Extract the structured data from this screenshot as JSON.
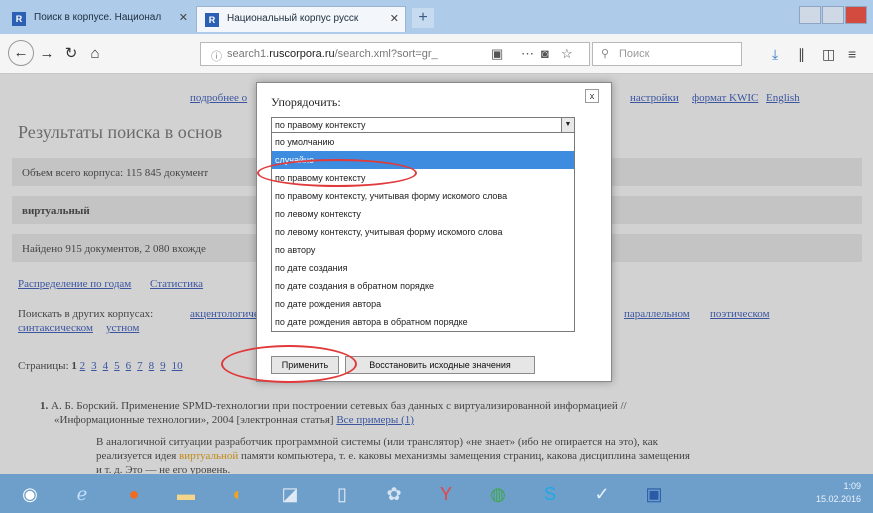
{
  "browser": {
    "tabs": [
      {
        "title": "Поиск в корпусе. Национал"
      },
      {
        "title": "Национальный корпус русск"
      }
    ],
    "new_tab": "+",
    "url": {
      "prefix": "search1.",
      "domain": "ruscorpora.ru",
      "path": "/search.xml?sort=gr_"
    },
    "search_placeholder": "Поиск"
  },
  "page": {
    "top_links": [
      "подробнее о",
      "настройки",
      "формат KWIC",
      "English"
    ],
    "title": "Результаты поиска в основ",
    "rows": [
      "Объем всего корпуса: 115 845 документ",
      "виртуальный",
      "Найдено 915 документов, 2 080 вхожде"
    ],
    "links1": [
      "Распределение по годам",
      "Статистика"
    ],
    "search_other_label": "Поискать в других корпусах:",
    "search_other_links": [
      "акцентологическом",
      "параллельном",
      "поэтическом",
      "синтаксическом",
      "устном"
    ],
    "pages_label": "Страницы:",
    "pages": [
      "1",
      "2",
      "3",
      "4",
      "5",
      "6",
      "7",
      "8",
      "9",
      "10"
    ],
    "result_num": "1.",
    "result_text": "А. Б. Борский. Применение SPMD-технологии при построении сетевых баз данных с виртуализированной информацией //",
    "result_text2": "«Информационные технологии», 2004   [электронная статья]",
    "result_link": "Все примеры (1)",
    "snippet1": "В аналогичной ситуации разработчик программной системы (или транслятор) «не знает» (ибо не опирается на это), как",
    "snippet2a": "реализуется идея",
    "snippet_highlight": "виртуальной",
    "snippet2b": "памяти компьютера, т. е. каковы механизмы замещения страниц, какова дисциплина замещения",
    "snippet3": "и т. д. Это — не его уровень."
  },
  "modal": {
    "title": "Упорядочить:",
    "close": "x",
    "selected": "по правому контексту",
    "options": [
      "по умолчанию",
      "случайно",
      "по правому контексту",
      "по правому контексту, учитывая форму искомого слова",
      "по левому контексту",
      "по левому контексту, учитывая форму искомого слова",
      "по автору",
      "по дате создания",
      "по дате создания в обратном порядке",
      "по дате рождения автора",
      "по дате рождения автора в обратном порядке"
    ],
    "highlighted_index": 1,
    "apply": "Применить",
    "reset": "Восстановить исходные значения"
  },
  "taskbar": {
    "time": "1:09",
    "date": "15.02.2016"
  },
  "colors": {
    "accent": "#3e8ce0",
    "annotation": "#e03a3a"
  }
}
